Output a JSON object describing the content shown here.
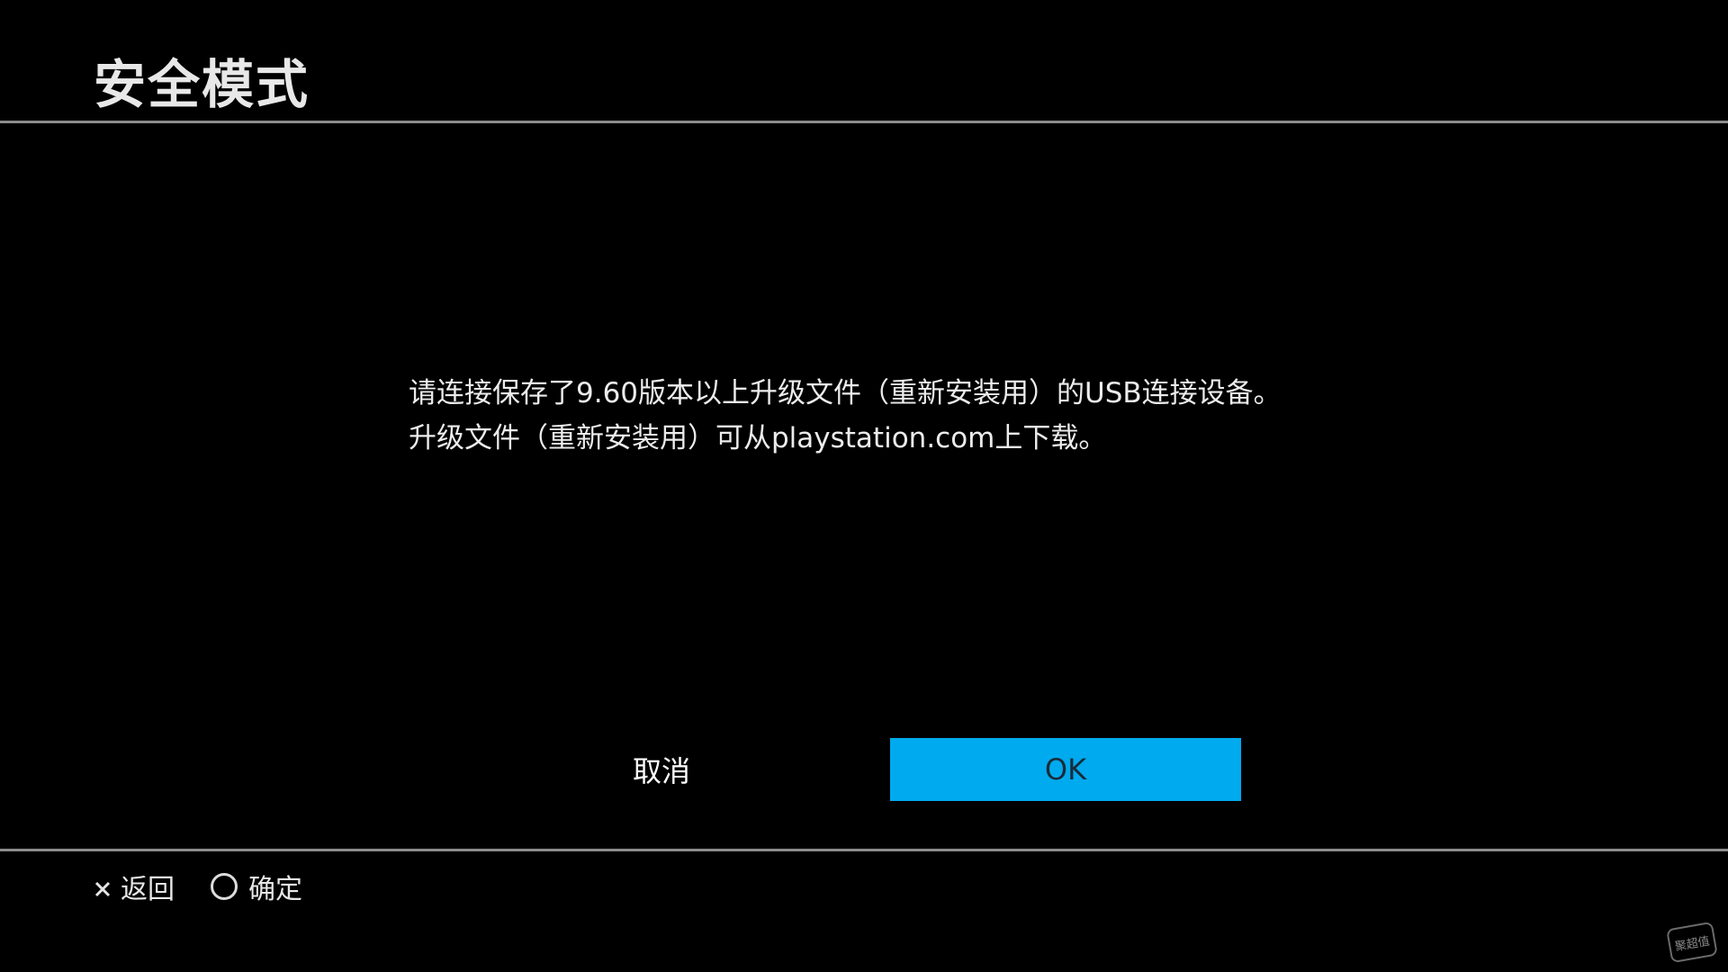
{
  "header": {
    "title": "安全模式"
  },
  "dialog": {
    "message_lines": [
      "请连接保存了9.60版本以上升级文件（重新安装用）的USB连接设备。",
      "升级文件（重新安装用）可从playstation.com上下载。"
    ],
    "cancel_label": "取消",
    "ok_label": "OK",
    "ok_color": "#00aaee"
  },
  "footer": {
    "back_icon": "cross-icon",
    "back_label": "返回",
    "confirm_icon": "circle-icon",
    "confirm_label": "确定"
  },
  "watermark": {
    "text": "聚超值"
  },
  "colors": {
    "background": "#000000",
    "divider": "#8c8c8c",
    "text": "#e6e6e6"
  }
}
